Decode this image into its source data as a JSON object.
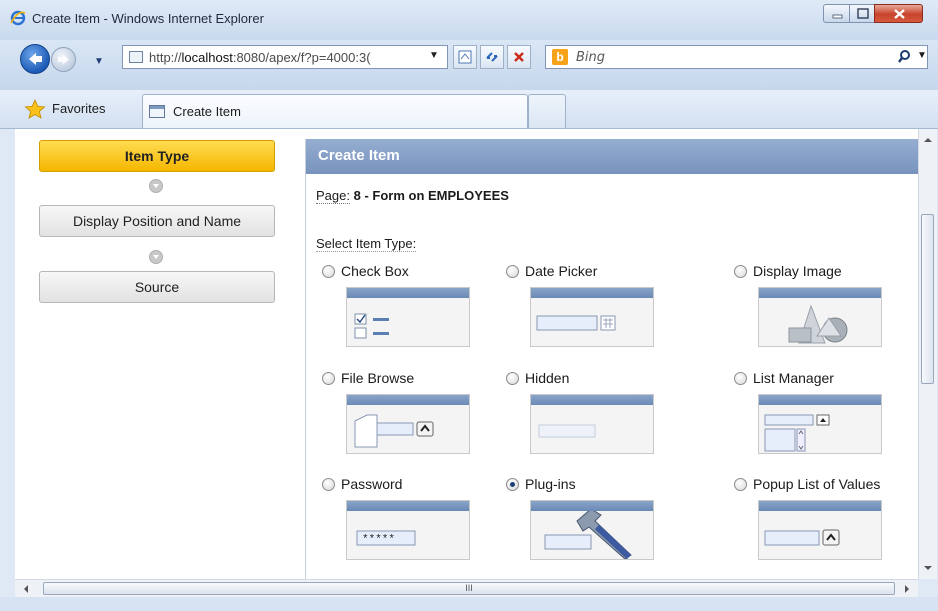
{
  "window": {
    "title": "Create Item - Windows Internet Explorer"
  },
  "address_bar": {
    "url_prefix": "http://",
    "url_host": "localhost",
    "url_rest": ":8080/apex/f?p=4000:3("
  },
  "search": {
    "placeholder": "Bing"
  },
  "favorites_bar": {
    "favorites_label": "Favorites",
    "tab_title": "Create Item"
  },
  "wizard": {
    "steps": [
      {
        "label": "Item Type",
        "active": true
      },
      {
        "label": "Display Position and Name",
        "active": false
      },
      {
        "label": "Source",
        "active": false
      }
    ]
  },
  "region": {
    "title": "Create Item",
    "page_label": "Page:",
    "page_value": "8 - Form on EMPLOYEES",
    "select_label": "Select Item Type:",
    "options": [
      {
        "label": "Check Box",
        "selected": false,
        "icon": "check-box-icon"
      },
      {
        "label": "Date Picker",
        "selected": false,
        "icon": "date-picker-icon"
      },
      {
        "label": "Display Image",
        "selected": false,
        "icon": "display-image-icon"
      },
      {
        "label": "File Browse",
        "selected": false,
        "icon": "file-browse-icon"
      },
      {
        "label": "Hidden",
        "selected": false,
        "icon": "hidden-icon"
      },
      {
        "label": "List Manager",
        "selected": false,
        "icon": "list-manager-icon"
      },
      {
        "label": "Password",
        "selected": false,
        "icon": "password-icon"
      },
      {
        "label": "Plug-ins",
        "selected": true,
        "icon": "plug-ins-icon"
      },
      {
        "label": "Popup List of Values",
        "selected": false,
        "icon": "popup-lov-icon"
      }
    ],
    "password_mask": "*****"
  },
  "scrollbar": {
    "grip": "III"
  }
}
